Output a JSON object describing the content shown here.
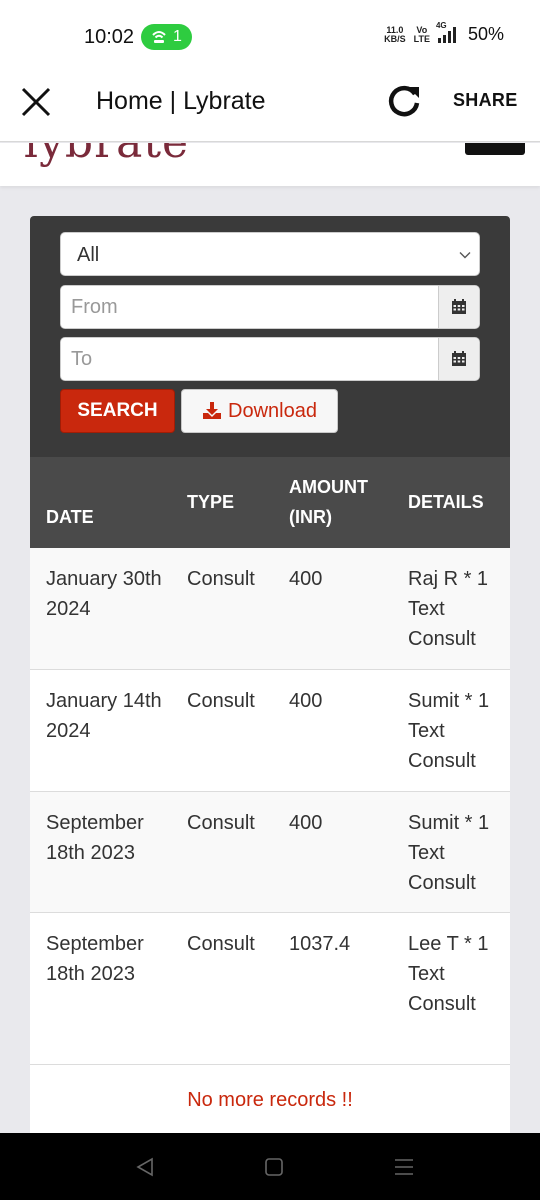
{
  "status_bar": {
    "time": "10:02",
    "hotspot_count": "1",
    "net_speed_value": "11.0",
    "net_speed_unit": "KB/S",
    "volte_top": "Vo",
    "volte_bottom": "LTE",
    "network": "4G",
    "battery": "50%"
  },
  "app_bar": {
    "title": "Home | Lybrate",
    "share_label": "SHARE"
  },
  "site_header": {
    "logo_text": "lybrate"
  },
  "filters": {
    "type_select": {
      "selected": "All"
    },
    "from_placeholder": "From",
    "to_placeholder": "To",
    "search_label": "SEARCH",
    "download_label": "Download"
  },
  "table": {
    "headers": {
      "date": "DATE",
      "type": "TYPE",
      "amount_line1": "AMOUNT",
      "amount_line2": "(INR)",
      "details": "DETAILS"
    },
    "rows": [
      {
        "date": "January 30th 2024",
        "type": "Consult",
        "amount": "400",
        "details": "Raj R * 1 Text Consult"
      },
      {
        "date": "January 14th 2024",
        "type": "Consult",
        "amount": "400",
        "details": "Sumit * 1 Text Consult"
      },
      {
        "date": "September 18th 2023",
        "type": "Consult",
        "amount": "400",
        "details": "Sumit * 1 Text Consult"
      },
      {
        "date": "September 18th 2023",
        "type": "Consult",
        "amount": "1037.4",
        "details": "Lee T * 1 Text Consult"
      }
    ],
    "footer_message": "No more records !!"
  },
  "colors": {
    "accent_red": "#c9280d",
    "panel_dark": "#3a3a3a",
    "header_gray": "#4a4a4a",
    "hotspot_green": "#2ecc40"
  }
}
